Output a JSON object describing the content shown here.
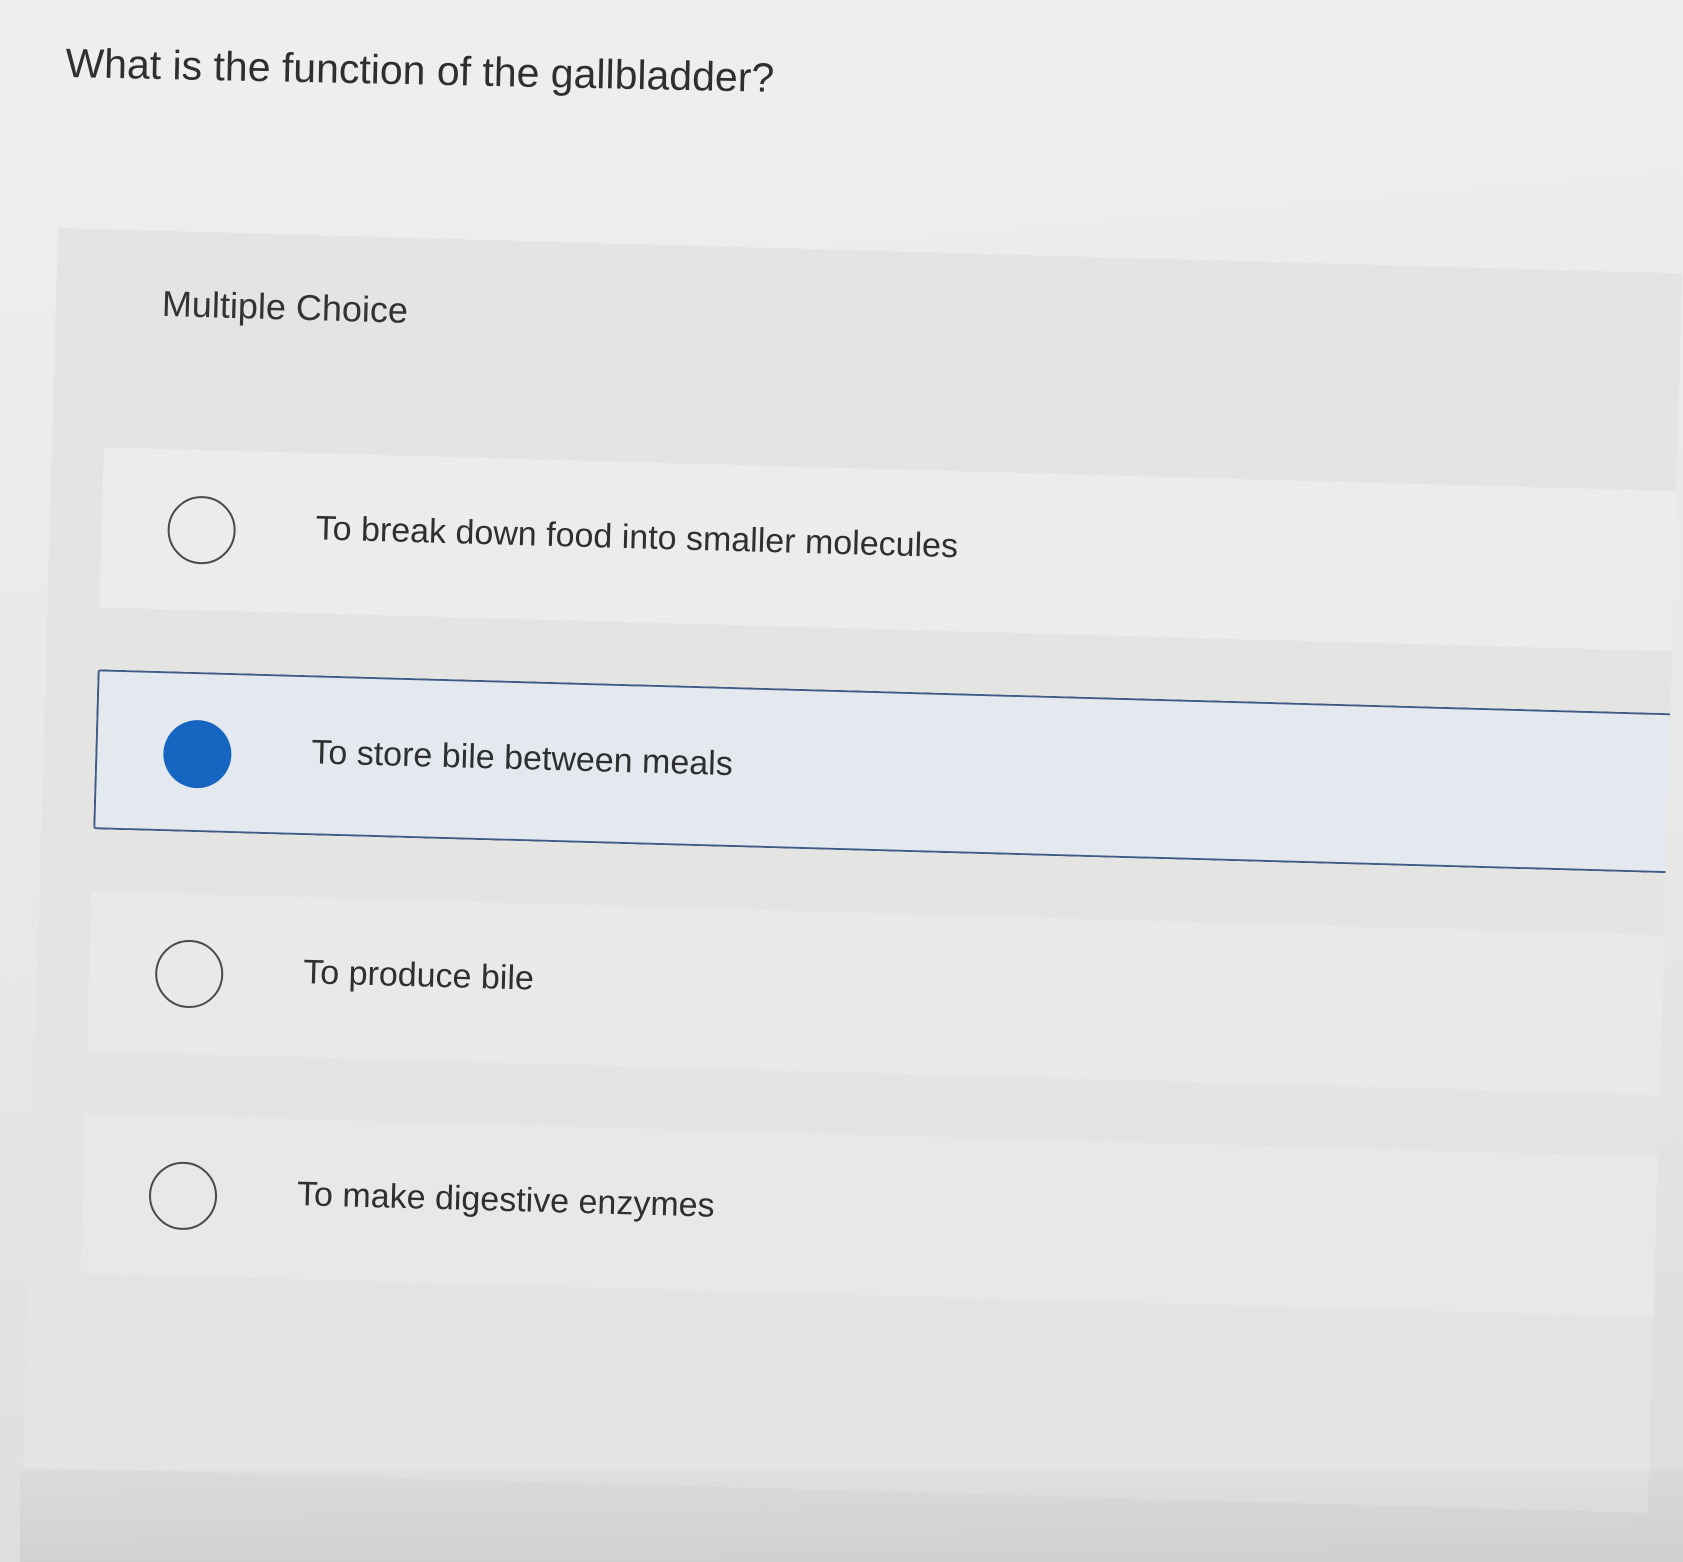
{
  "question": {
    "text": "What is the function of the gallbladder?"
  },
  "panel": {
    "label": "Multiple Choice"
  },
  "options": [
    {
      "label": "To break down food into smaller molecules",
      "selected": false
    },
    {
      "label": "To store bile between meals",
      "selected": true
    },
    {
      "label": "To produce bile",
      "selected": false
    },
    {
      "label": "To make digestive enzymes",
      "selected": false
    }
  ],
  "colors": {
    "selected_radio": "#1665c1",
    "selected_border": "#3f5a86",
    "selected_background": "#e3e9ee"
  }
}
